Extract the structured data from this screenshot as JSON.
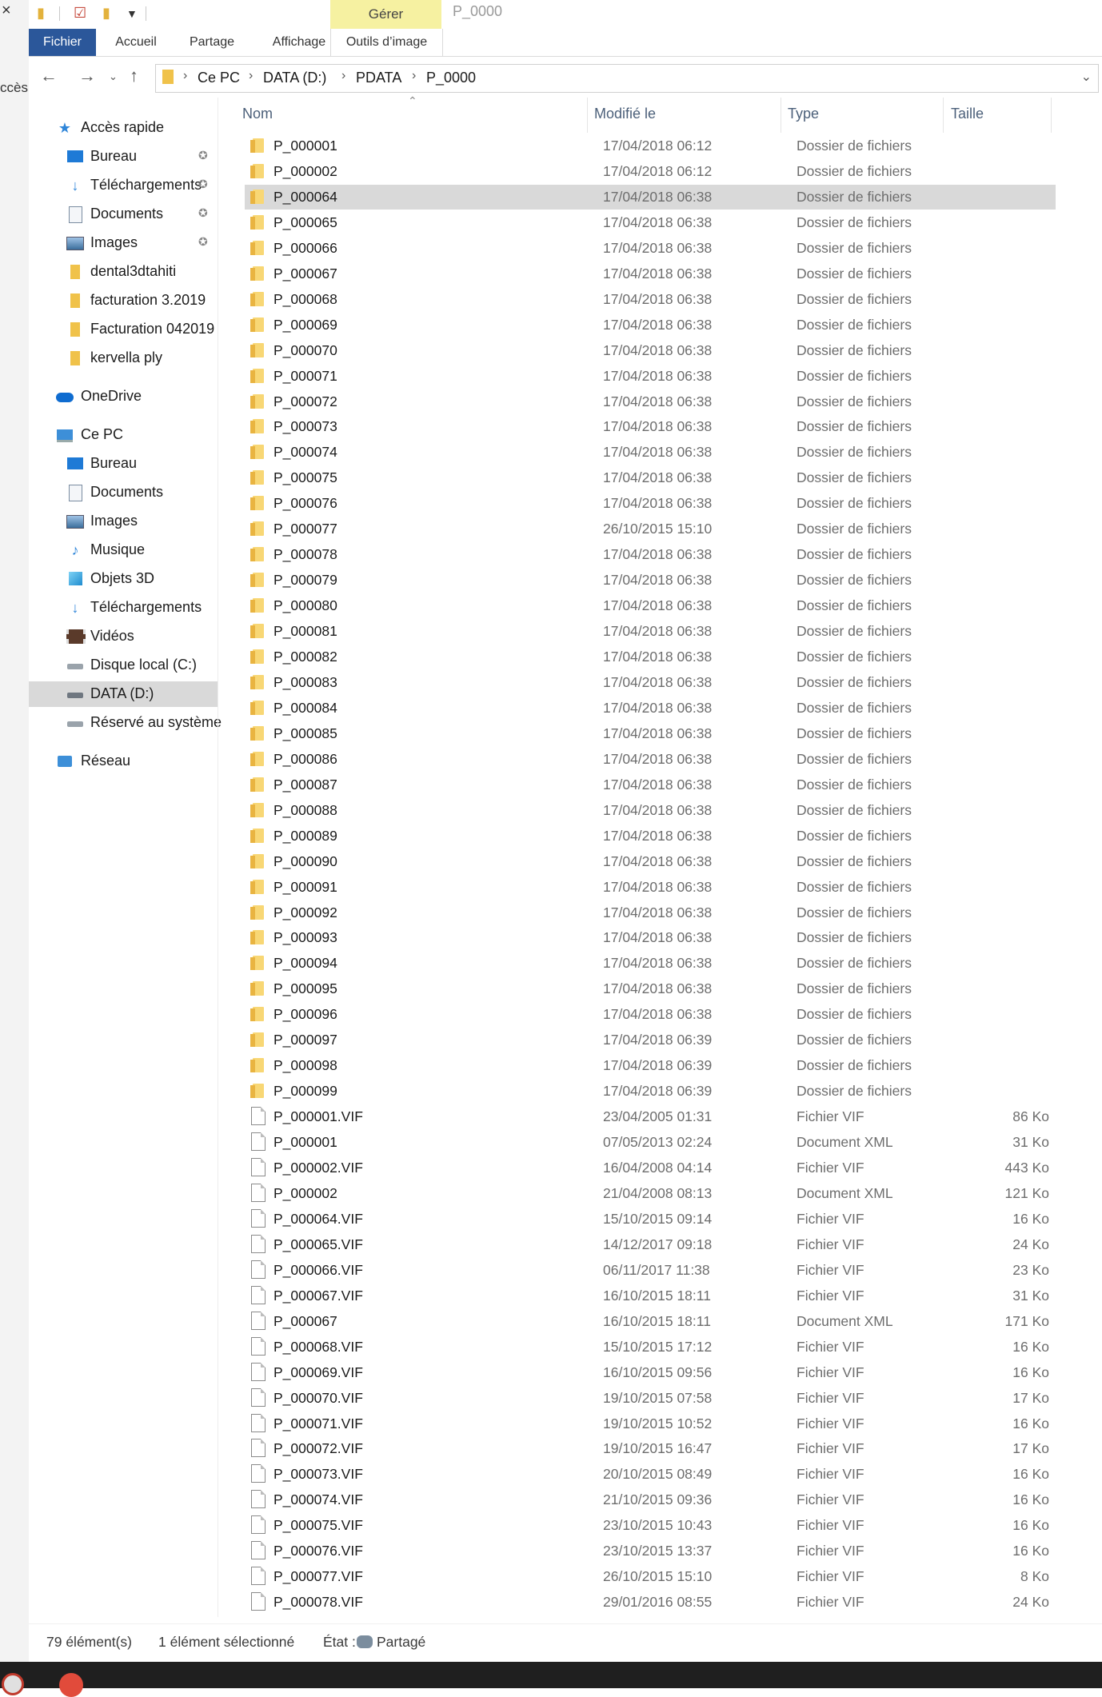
{
  "window_title": "P_0000",
  "left_strip": {
    "close_glyph": "×",
    "text": "ccès"
  },
  "ribbon": {
    "manage_label": "Gérer",
    "tabs": [
      "Fichier",
      "Accueil",
      "Partage",
      "Affichage",
      "Outils d’image"
    ]
  },
  "address": {
    "crumbs": [
      "Ce PC",
      "DATA (D:)",
      "PDATA",
      "P_0000"
    ]
  },
  "sidebar": {
    "items": [
      {
        "label": "Accès rapide",
        "icon": "star-icon"
      },
      {
        "label": "Bureau",
        "icon": "desktop-icon",
        "pinned": true
      },
      {
        "label": "Téléchargements",
        "icon": "download-icon",
        "pinned": true
      },
      {
        "label": "Documents",
        "icon": "documents-icon",
        "pinned": true
      },
      {
        "label": "Images",
        "icon": "images-icon",
        "pinned": true
      },
      {
        "label": "dental3dtahiti",
        "icon": "folder-icon"
      },
      {
        "label": "facturation 3.2019",
        "icon": "folder-icon"
      },
      {
        "label": "Facturation 042019",
        "icon": "folder-icon"
      },
      {
        "label": "kervella ply",
        "icon": "folder-icon"
      },
      {
        "label": "OneDrive",
        "icon": "cloud-icon"
      },
      {
        "label": "Ce PC",
        "icon": "computer-icon"
      },
      {
        "label": "Bureau",
        "icon": "desktop-icon"
      },
      {
        "label": "Documents",
        "icon": "documents-icon"
      },
      {
        "label": "Images",
        "icon": "images-icon"
      },
      {
        "label": "Musique",
        "icon": "music-icon"
      },
      {
        "label": "Objets 3D",
        "icon": "cube-icon"
      },
      {
        "label": "Téléchargements",
        "icon": "download-icon"
      },
      {
        "label": "Vidéos",
        "icon": "video-icon"
      },
      {
        "label": "Disque local (C:)",
        "icon": "drive-icon"
      },
      {
        "label": "DATA (D:)",
        "icon": "drive-icon",
        "selected": true
      },
      {
        "label": "Réservé au système",
        "icon": "drive-icon"
      },
      {
        "label": "Réseau",
        "icon": "network-icon"
      }
    ]
  },
  "columns": [
    "Nom",
    "Modifié le",
    "Type",
    "Taille"
  ],
  "files": [
    {
      "name": "P_000001",
      "date": "17/04/2018 06:12",
      "type": "Dossier de fichiers",
      "size": "",
      "kind": "folder"
    },
    {
      "name": "P_000002",
      "date": "17/04/2018 06:12",
      "type": "Dossier de fichiers",
      "size": "",
      "kind": "folder"
    },
    {
      "name": "P_000064",
      "date": "17/04/2018 06:38",
      "type": "Dossier de fichiers",
      "size": "",
      "kind": "folder",
      "selected": true
    },
    {
      "name": "P_000065",
      "date": "17/04/2018 06:38",
      "type": "Dossier de fichiers",
      "size": "",
      "kind": "folder"
    },
    {
      "name": "P_000066",
      "date": "17/04/2018 06:38",
      "type": "Dossier de fichiers",
      "size": "",
      "kind": "folder"
    },
    {
      "name": "P_000067",
      "date": "17/04/2018 06:38",
      "type": "Dossier de fichiers",
      "size": "",
      "kind": "folder"
    },
    {
      "name": "P_000068",
      "date": "17/04/2018 06:38",
      "type": "Dossier de fichiers",
      "size": "",
      "kind": "folder"
    },
    {
      "name": "P_000069",
      "date": "17/04/2018 06:38",
      "type": "Dossier de fichiers",
      "size": "",
      "kind": "folder"
    },
    {
      "name": "P_000070",
      "date": "17/04/2018 06:38",
      "type": "Dossier de fichiers",
      "size": "",
      "kind": "folder"
    },
    {
      "name": "P_000071",
      "date": "17/04/2018 06:38",
      "type": "Dossier de fichiers",
      "size": "",
      "kind": "folder"
    },
    {
      "name": "P_000072",
      "date": "17/04/2018 06:38",
      "type": "Dossier de fichiers",
      "size": "",
      "kind": "folder"
    },
    {
      "name": "P_000073",
      "date": "17/04/2018 06:38",
      "type": "Dossier de fichiers",
      "size": "",
      "kind": "folder"
    },
    {
      "name": "P_000074",
      "date": "17/04/2018 06:38",
      "type": "Dossier de fichiers",
      "size": "",
      "kind": "folder"
    },
    {
      "name": "P_000075",
      "date": "17/04/2018 06:38",
      "type": "Dossier de fichiers",
      "size": "",
      "kind": "folder"
    },
    {
      "name": "P_000076",
      "date": "17/04/2018 06:38",
      "type": "Dossier de fichiers",
      "size": "",
      "kind": "folder"
    },
    {
      "name": "P_000077",
      "date": "26/10/2015 15:10",
      "type": "Dossier de fichiers",
      "size": "",
      "kind": "folder"
    },
    {
      "name": "P_000078",
      "date": "17/04/2018 06:38",
      "type": "Dossier de fichiers",
      "size": "",
      "kind": "folder"
    },
    {
      "name": "P_000079",
      "date": "17/04/2018 06:38",
      "type": "Dossier de fichiers",
      "size": "",
      "kind": "folder"
    },
    {
      "name": "P_000080",
      "date": "17/04/2018 06:38",
      "type": "Dossier de fichiers",
      "size": "",
      "kind": "folder"
    },
    {
      "name": "P_000081",
      "date": "17/04/2018 06:38",
      "type": "Dossier de fichiers",
      "size": "",
      "kind": "folder"
    },
    {
      "name": "P_000082",
      "date": "17/04/2018 06:38",
      "type": "Dossier de fichiers",
      "size": "",
      "kind": "folder"
    },
    {
      "name": "P_000083",
      "date": "17/04/2018 06:38",
      "type": "Dossier de fichiers",
      "size": "",
      "kind": "folder"
    },
    {
      "name": "P_000084",
      "date": "17/04/2018 06:38",
      "type": "Dossier de fichiers",
      "size": "",
      "kind": "folder"
    },
    {
      "name": "P_000085",
      "date": "17/04/2018 06:38",
      "type": "Dossier de fichiers",
      "size": "",
      "kind": "folder"
    },
    {
      "name": "P_000086",
      "date": "17/04/2018 06:38",
      "type": "Dossier de fichiers",
      "size": "",
      "kind": "folder"
    },
    {
      "name": "P_000087",
      "date": "17/04/2018 06:38",
      "type": "Dossier de fichiers",
      "size": "",
      "kind": "folder"
    },
    {
      "name": "P_000088",
      "date": "17/04/2018 06:38",
      "type": "Dossier de fichiers",
      "size": "",
      "kind": "folder"
    },
    {
      "name": "P_000089",
      "date": "17/04/2018 06:38",
      "type": "Dossier de fichiers",
      "size": "",
      "kind": "folder"
    },
    {
      "name": "P_000090",
      "date": "17/04/2018 06:38",
      "type": "Dossier de fichiers",
      "size": "",
      "kind": "folder"
    },
    {
      "name": "P_000091",
      "date": "17/04/2018 06:38",
      "type": "Dossier de fichiers",
      "size": "",
      "kind": "folder"
    },
    {
      "name": "P_000092",
      "date": "17/04/2018 06:38",
      "type": "Dossier de fichiers",
      "size": "",
      "kind": "folder"
    },
    {
      "name": "P_000093",
      "date": "17/04/2018 06:38",
      "type": "Dossier de fichiers",
      "size": "",
      "kind": "folder"
    },
    {
      "name": "P_000094",
      "date": "17/04/2018 06:38",
      "type": "Dossier de fichiers",
      "size": "",
      "kind": "folder"
    },
    {
      "name": "P_000095",
      "date": "17/04/2018 06:38",
      "type": "Dossier de fichiers",
      "size": "",
      "kind": "folder"
    },
    {
      "name": "P_000096",
      "date": "17/04/2018 06:38",
      "type": "Dossier de fichiers",
      "size": "",
      "kind": "folder"
    },
    {
      "name": "P_000097",
      "date": "17/04/2018 06:39",
      "type": "Dossier de fichiers",
      "size": "",
      "kind": "folder"
    },
    {
      "name": "P_000098",
      "date": "17/04/2018 06:39",
      "type": "Dossier de fichiers",
      "size": "",
      "kind": "folder"
    },
    {
      "name": "P_000099",
      "date": "17/04/2018 06:39",
      "type": "Dossier de fichiers",
      "size": "",
      "kind": "folder"
    },
    {
      "name": "P_000001.VIF",
      "date": "23/04/2005 01:31",
      "type": "Fichier VIF",
      "size": "86 Ko",
      "kind": "file"
    },
    {
      "name": "P_000001",
      "date": "07/05/2013 02:24",
      "type": "Document XML",
      "size": "31 Ko",
      "kind": "file"
    },
    {
      "name": "P_000002.VIF",
      "date": "16/04/2008 04:14",
      "type": "Fichier VIF",
      "size": "443 Ko",
      "kind": "file"
    },
    {
      "name": "P_000002",
      "date": "21/04/2008 08:13",
      "type": "Document XML",
      "size": "121 Ko",
      "kind": "file"
    },
    {
      "name": "P_000064.VIF",
      "date": "15/10/2015 09:14",
      "type": "Fichier VIF",
      "size": "16 Ko",
      "kind": "file"
    },
    {
      "name": "P_000065.VIF",
      "date": "14/12/2017 09:18",
      "type": "Fichier VIF",
      "size": "24 Ko",
      "kind": "file"
    },
    {
      "name": "P_000066.VIF",
      "date": "06/11/2017 11:38",
      "type": "Fichier VIF",
      "size": "23 Ko",
      "kind": "file"
    },
    {
      "name": "P_000067.VIF",
      "date": "16/10/2015 18:11",
      "type": "Fichier VIF",
      "size": "31 Ko",
      "kind": "file"
    },
    {
      "name": "P_000067",
      "date": "16/10/2015 18:11",
      "type": "Document XML",
      "size": "171 Ko",
      "kind": "file"
    },
    {
      "name": "P_000068.VIF",
      "date": "15/10/2015 17:12",
      "type": "Fichier VIF",
      "size": "16 Ko",
      "kind": "file"
    },
    {
      "name": "P_000069.VIF",
      "date": "16/10/2015 09:56",
      "type": "Fichier VIF",
      "size": "16 Ko",
      "kind": "file"
    },
    {
      "name": "P_000070.VIF",
      "date": "19/10/2015 07:58",
      "type": "Fichier VIF",
      "size": "17 Ko",
      "kind": "file"
    },
    {
      "name": "P_000071.VIF",
      "date": "19/10/2015 10:52",
      "type": "Fichier VIF",
      "size": "16 Ko",
      "kind": "file"
    },
    {
      "name": "P_000072.VIF",
      "date": "19/10/2015 16:47",
      "type": "Fichier VIF",
      "size": "17 Ko",
      "kind": "file"
    },
    {
      "name": "P_000073.VIF",
      "date": "20/10/2015 08:49",
      "type": "Fichier VIF",
      "size": "16 Ko",
      "kind": "file"
    },
    {
      "name": "P_000074.VIF",
      "date": "21/10/2015 09:36",
      "type": "Fichier VIF",
      "size": "16 Ko",
      "kind": "file"
    },
    {
      "name": "P_000075.VIF",
      "date": "23/10/2015 10:43",
      "type": "Fichier VIF",
      "size": "16 Ko",
      "kind": "file"
    },
    {
      "name": "P_000076.VIF",
      "date": "23/10/2015 13:37",
      "type": "Fichier VIF",
      "size": "16 Ko",
      "kind": "file"
    },
    {
      "name": "P_000077.VIF",
      "date": "26/10/2015 15:10",
      "type": "Fichier VIF",
      "size": "8 Ko",
      "kind": "file"
    },
    {
      "name": "P_000078.VIF",
      "date": "29/01/2016 08:55",
      "type": "Fichier VIF",
      "size": "24 Ko",
      "kind": "file"
    }
  ],
  "status": {
    "count": "79 élément(s)",
    "selected": "1 élément sélectionné",
    "state_label": "État :",
    "state_value": "Partagé"
  }
}
